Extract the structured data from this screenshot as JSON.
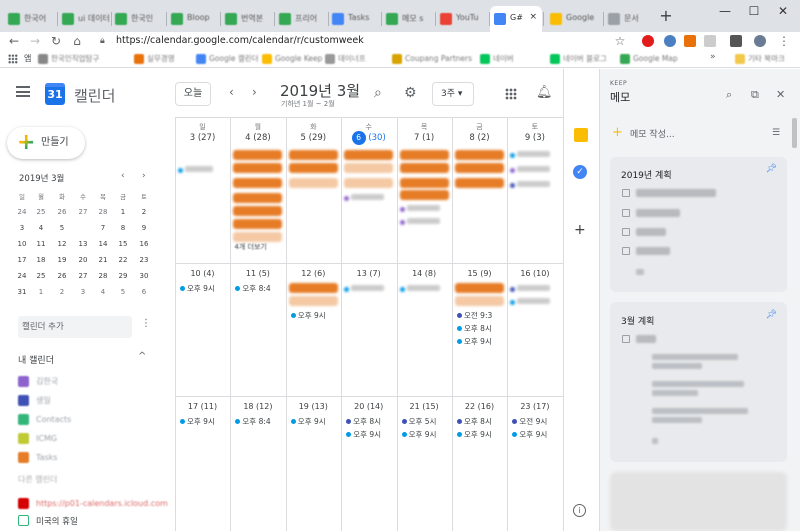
{
  "browser": {
    "tabs": [
      {
        "label": "한국어",
        "color": "#34a853"
      },
      {
        "label": "ui 데이터",
        "color": "#34a853"
      },
      {
        "label": "한국인",
        "color": "#34a853"
      },
      {
        "label": "Bloop",
        "color": "#34a853"
      },
      {
        "label": "번역본",
        "color": "#34a853"
      },
      {
        "label": "프리어",
        "color": "#34a853"
      },
      {
        "label": "Tasks",
        "color": "#4285f4"
      },
      {
        "label": "메모 s",
        "color": "#34a853"
      },
      {
        "label": "YouTu",
        "color": "#ea4335"
      },
      {
        "label": "G#",
        "color": "#4285f4",
        "active": true
      },
      {
        "label": "Google",
        "color": "#fbbc04"
      },
      {
        "label": "문서",
        "color": "#9aa0a6"
      }
    ],
    "new_tab": "+",
    "window_minimize": "—",
    "window_maximize": "☐",
    "window_close": "✕",
    "url": "https://calendar.google.com/calendar/r/customweek",
    "bookmarks_label": "앱",
    "bookmarks": [
      "한국인직업탐구",
      "실무경영",
      "Google 캘린더",
      "Google Keep",
      "데이너프",
      "Coupang Partners",
      "네이버",
      "네이버 블로그",
      "Google Map"
    ],
    "bookmarks_more": "»",
    "other_bookmarks": "기타 북마크"
  },
  "header": {
    "logo_day": "31",
    "app_title": "캘린더",
    "today_button": "오늘",
    "prev": "‹",
    "next": "›",
    "month_title": "2019년 3월",
    "subtitle": "기하년 1월 ~ 2월",
    "view_select": "3주 ▾"
  },
  "sidebar": {
    "create_label": "만들기",
    "mini_title": "2019년 3월",
    "mini_prev": "‹",
    "mini_next": "›",
    "mini_dows": [
      "일",
      "월",
      "화",
      "수",
      "목",
      "금",
      "토"
    ],
    "mini_weeks": [
      [
        "24",
        "25",
        "26",
        "27",
        "28",
        "1",
        "2"
      ],
      [
        "3",
        "4",
        "5",
        "6",
        "7",
        "8",
        "9"
      ],
      [
        "10",
        "11",
        "12",
        "13",
        "14",
        "15",
        "16"
      ],
      [
        "17",
        "18",
        "19",
        "20",
        "21",
        "22",
        "23"
      ],
      [
        "24",
        "25",
        "26",
        "27",
        "28",
        "29",
        "30"
      ],
      [
        "31",
        "1",
        "2",
        "3",
        "4",
        "5",
        "6"
      ]
    ],
    "add_calendar": "캘린더 추가",
    "add_calendar_more": "⋮",
    "my_calendars": "내 캘린더",
    "my_calendars_toggle": "^",
    "calendars": [
      {
        "label": "김한국",
        "color": "#8e63ce"
      },
      {
        "label": "생일",
        "color": "#3f51b5"
      },
      {
        "label": "Contacts",
        "color": "#33b679"
      },
      {
        "label": "ICMG",
        "color": "#c0ca33"
      },
      {
        "label": "Tasks",
        "color": "#e67c26"
      }
    ],
    "other_calendars": "다른 캘린더",
    "other_url": "https://p01-calendars.icloud.com",
    "other_url_color": "#d50000",
    "holiday_label": "미국의 휴일"
  },
  "grid": {
    "dows": [
      "일",
      "월",
      "화",
      "수",
      "목",
      "금",
      "토"
    ],
    "header_dates": [
      "3 (27)",
      "4 (28)",
      "5 (29)",
      "6",
      "7 (1)",
      "8 (2)",
      "9 (3)"
    ],
    "today_num": "6",
    "today_lunar": "(30)",
    "week2_dates": [
      "10 (4)",
      "11 (5)",
      "12 (6)",
      "13 (7)",
      "14 (8)",
      "15 (9)",
      "16 (10)"
    ],
    "week3_dates": [
      "17 (11)",
      "18 (12)",
      "19 (13)",
      "20 (14)",
      "21 (15)",
      "22 (16)",
      "23 (17)"
    ],
    "more_label": "4개 더보기",
    "events": {
      "w2_sun": "오후 9시",
      "w2_mon": "오후 8:4",
      "w2_tue": "오후 9시",
      "w2_fri_1": "오전 9:3",
      "w2_fri_2": "오후 8시",
      "w2_fri_3": "오후 9시",
      "w3_sun": "오후 9시",
      "w3_mon": "오후 8:4",
      "w3_tue": "오후 9시",
      "w3_wed_1": "오후 8시",
      "w3_wed_2": "오후 9시",
      "w3_thu_1": "오후 5시",
      "w3_thu_2": "오후 9시",
      "w3_fri_1": "오후 8시",
      "w3_fri_2": "오후 9시",
      "w3_sat_1": "오전 9시",
      "w3_sat_2": "오후 9시"
    }
  },
  "keep": {
    "label": "KEEP",
    "title": "메모",
    "create_label": "메모 작성...",
    "card1_title": "2019년 계획",
    "card2_title": "3월 계획"
  },
  "colors": {
    "accent": "#1a73e8",
    "event_orange": "#e67c26",
    "keep_yellow": "#fbbc04"
  }
}
